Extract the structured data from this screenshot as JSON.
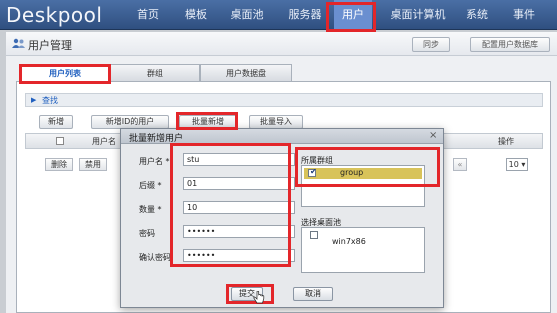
{
  "app": {
    "logo": "Deskpool"
  },
  "nav": {
    "items": [
      {
        "label": "首页"
      },
      {
        "label": "模板"
      },
      {
        "label": "桌面池"
      },
      {
        "label": "服务器"
      },
      {
        "label": "用户",
        "active": true
      },
      {
        "label": "桌面计算机"
      },
      {
        "label": "系统"
      },
      {
        "label": "事件"
      }
    ]
  },
  "page": {
    "title": "用户管理",
    "sync_label": "同步",
    "config_db_label": "配置用户数据库"
  },
  "tabs": [
    {
      "label": "用户列表",
      "active": true
    },
    {
      "label": "群组"
    },
    {
      "label": "用户数据盘"
    }
  ],
  "search": {
    "label": "查找"
  },
  "toolbar": {
    "add_label": "新增",
    "add_ad_label": "新增ID的用户",
    "batch_add_label": "批量新增",
    "batch_import_label": "批量导入"
  },
  "grid": {
    "col_username": "用户名",
    "col_actions": "操作",
    "delete_label": "删除",
    "disable_label": "禁用",
    "page_size": "10"
  },
  "modal": {
    "title": "批量新增用户",
    "fields": {
      "prefix_label": "用户名 *",
      "prefix_value": "stu",
      "suffix_label": "后缀 *",
      "suffix_value": "01",
      "count_label": "数量 *",
      "count_value": "10",
      "password_label": "密码",
      "password_value": "••••••",
      "confirm_label": "确认密码",
      "confirm_value": "••••••"
    },
    "group_section_label": "所属群组",
    "group_name": "group",
    "pool_section_label": "选择桌面池",
    "pool_name": "win7x86",
    "submit_label": "提交",
    "cancel_label": "取消"
  },
  "colors": {
    "highlight": "#e3262a",
    "topbar": "#2f4f80",
    "active_nav": "#6a8fd0",
    "selected_group": "#d8c35a"
  }
}
